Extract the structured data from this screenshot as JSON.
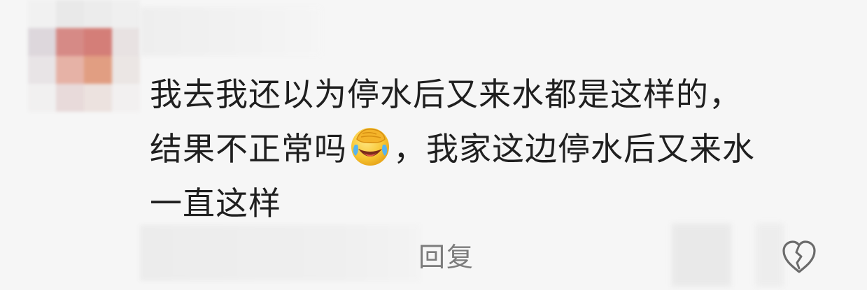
{
  "comment": {
    "text_line1": "我去我还以为停水后又来水都是这样的，",
    "text_line2_before_emoji": "结果不正常吗",
    "text_line2_after_emoji": "，我家这边停水后又来水",
    "text_line3": "一直这样",
    "emoji_icon": "face-palm-crying-emoji"
  },
  "actions": {
    "reply_label": "回复",
    "like_icon": "broken-heart-icon"
  }
}
